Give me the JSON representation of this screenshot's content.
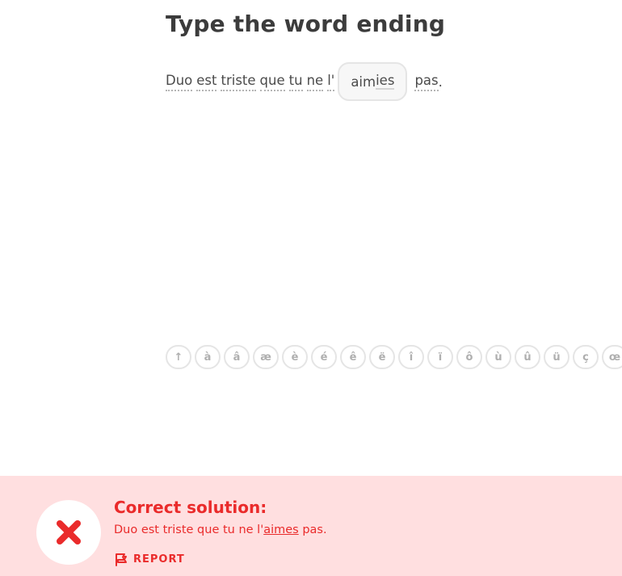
{
  "challenge": {
    "title": "Type the word ending",
    "words": [
      "Duo",
      "est",
      "triste",
      "que",
      "tu",
      "ne",
      "l'"
    ],
    "blank_prefix": "aim",
    "blank_typed": "ies",
    "after_word": "pas",
    "after_punct": "."
  },
  "keyboard": {
    "keys": [
      "↑",
      "à",
      "â",
      "æ",
      "è",
      "é",
      "ê",
      "ë",
      "î",
      "ï",
      "ô",
      "ù",
      "û",
      "ü",
      "ç",
      "œ"
    ]
  },
  "feedback": {
    "title": "Correct solution:",
    "solution_before": "Duo est triste que tu ne l'",
    "solution_highlight": "aimes",
    "solution_after": " pas.",
    "report_label": "REPORT",
    "status_icon": "x-mark-icon",
    "accent_color": "#ea2b2b",
    "background_color": "#ffdfe0"
  }
}
